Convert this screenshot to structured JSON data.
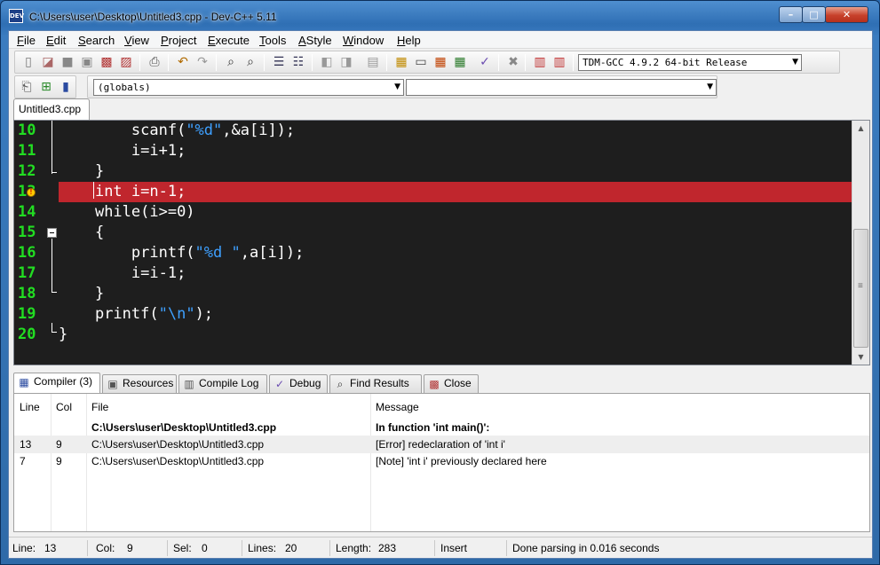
{
  "window": {
    "title": "C:\\Users\\user\\Desktop\\Untitled3.cpp - Dev-C++ 5.11",
    "min_glyph": "–",
    "max_glyph": "□",
    "close_glyph": "✕"
  },
  "menu": [
    {
      "key": "F",
      "rest": "ile"
    },
    {
      "key": "E",
      "rest": "dit"
    },
    {
      "key": "S",
      "rest": "earch"
    },
    {
      "key": "V",
      "rest": "iew"
    },
    {
      "key": "P",
      "rest": "roject"
    },
    {
      "key": "E",
      "rest": "xecute"
    },
    {
      "key": "T",
      "rest": "ools"
    },
    {
      "key": "A",
      "rest": "Style"
    },
    {
      "key": "W",
      "rest": "indow"
    },
    {
      "key": "H",
      "rest": "elp"
    }
  ],
  "toolbar": {
    "compiler_select": "TDM-GCC 4.9.2 64-bit Release",
    "scope_select": "(globals)",
    "member_select": ""
  },
  "file_tab": "Untitled3.cpp",
  "editor": {
    "line_numbers": [
      "10",
      "11",
      "12",
      "13",
      "14",
      "15",
      "16",
      "17",
      "18",
      "19",
      "20"
    ],
    "error_line": "13",
    "lines": [
      {
        "indent": "        ",
        "parts": [
          [
            "scanf(",
            "n"
          ],
          [
            "\"%d\"",
            "s"
          ],
          [
            ",&a[i]);",
            "n"
          ]
        ]
      },
      {
        "indent": "        ",
        "parts": [
          [
            "i=i+1;",
            "n"
          ]
        ]
      },
      {
        "indent": "    ",
        "parts": [
          [
            "}",
            "n"
          ]
        ]
      },
      {
        "indent": "    ",
        "parts": [
          [
            "int i=n-1;",
            "n"
          ]
        ]
      },
      {
        "indent": "    ",
        "parts": [
          [
            "while(i>=0)",
            "n"
          ]
        ]
      },
      {
        "indent": "    ",
        "parts": [
          [
            "{",
            "n"
          ]
        ]
      },
      {
        "indent": "        ",
        "parts": [
          [
            "printf(",
            "n"
          ],
          [
            "\"%d \"",
            "s"
          ],
          [
            ",a[i]);",
            "n"
          ]
        ]
      },
      {
        "indent": "        ",
        "parts": [
          [
            "i=i-1;",
            "n"
          ]
        ]
      },
      {
        "indent": "    ",
        "parts": [
          [
            "}",
            "n"
          ]
        ]
      },
      {
        "indent": "    ",
        "parts": [
          [
            "printf(",
            "n"
          ],
          [
            "\"\\n\"",
            "s"
          ],
          [
            ");",
            "n"
          ]
        ]
      },
      {
        "indent": "",
        "parts": [
          [
            "}",
            "n"
          ]
        ]
      }
    ]
  },
  "bottom_tabs": [
    {
      "label": "Compiler (3)",
      "icon": "compiler-icon"
    },
    {
      "label": "Resources",
      "icon": "resources-icon"
    },
    {
      "label": "Compile Log",
      "icon": "compile-log-icon"
    },
    {
      "label": "Debug",
      "icon": "debug-icon"
    },
    {
      "label": "Find Results",
      "icon": "find-results-icon"
    },
    {
      "label": "Close",
      "icon": "close-panel-icon"
    }
  ],
  "messages": {
    "headers": {
      "line": "Line",
      "col": "Col",
      "file": "File",
      "message": "Message"
    },
    "rows": [
      {
        "line": "",
        "col": "",
        "file": "C:\\Users\\user\\Desktop\\Untitled3.cpp",
        "message": "In function 'int main()':",
        "bold": true
      },
      {
        "line": "13",
        "col": "9",
        "file": "C:\\Users\\user\\Desktop\\Untitled3.cpp",
        "message": "[Error] redeclaration of 'int i'",
        "bold": false
      },
      {
        "line": "7",
        "col": "9",
        "file": "C:\\Users\\user\\Desktop\\Untitled3.cpp",
        "message": "[Note] 'int i' previously declared here",
        "bold": false
      }
    ]
  },
  "status": {
    "line_label": "Line:",
    "line_value": "13",
    "col_label": "Col:",
    "col_value": "9",
    "sel_label": "Sel:",
    "sel_value": "0",
    "lines_label": "Lines:",
    "lines_value": "20",
    "length_label": "Length:",
    "length_value": "283",
    "mode": "Insert",
    "message": "Done parsing in 0.016 seconds"
  },
  "colors": {
    "editor_bg": "#1e1e1e",
    "line_number": "#22dd22",
    "string": "#3ea0ff",
    "error_line_bg": "#c0262d"
  }
}
